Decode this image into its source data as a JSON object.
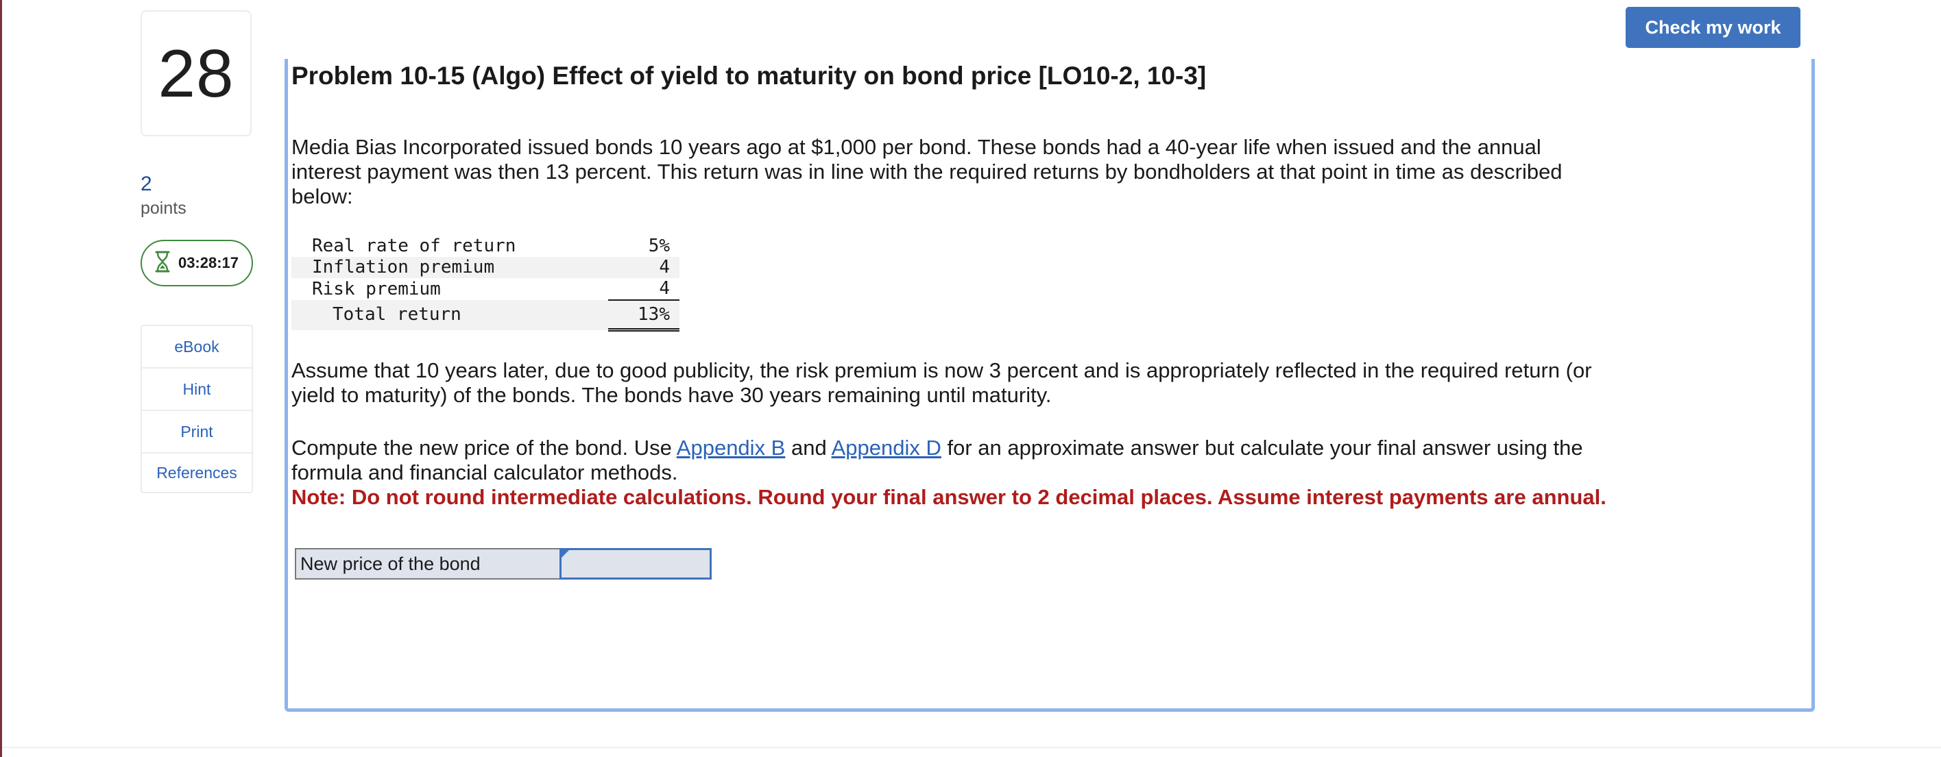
{
  "question": {
    "number": "28",
    "points_value": "2",
    "points_label": "points",
    "timer": "03:28:17"
  },
  "tools": [
    {
      "label": "eBook"
    },
    {
      "label": "Hint"
    },
    {
      "label": "Print"
    },
    {
      "label": "References"
    }
  ],
  "toolbar": {
    "check_label": "Check my work"
  },
  "problem": {
    "title": "Problem 10-15 (Algo) Effect of yield to maturity on bond price [LO10-2, 10-3]",
    "intro": "Media Bias Incorporated issued bonds 10 years ago at $1,000 per bond. These bonds had a 40-year life when issued and the annual interest payment was then 13 percent. This return was in line with the required returns by bondholders at that point in time as described below:",
    "returns_table": [
      {
        "label": "Real rate of return",
        "value": "5%"
      },
      {
        "label": "Inflation premium",
        "value": "4"
      },
      {
        "label": "Risk premium",
        "value": "4"
      },
      {
        "label": "Total return",
        "value": "13%"
      }
    ],
    "assumption": "Assume that 10 years later, due to good publicity, the risk premium is now 3 percent and is appropriately reflected in the required return (or yield to maturity) of the bonds. The bonds have 30 years remaining until maturity.",
    "compute_pre": "Compute the new price of the bond. Use ",
    "appendix_b": "Appendix B",
    "compute_and": " and ",
    "appendix_d": "Appendix D",
    "compute_post": " for an approximate answer but calculate your final answer using the formula and financial calculator methods.",
    "note": "Note: Do not round intermediate calculations. Round your final answer to 2 decimal places. Assume interest payments are annual."
  },
  "answer": {
    "label": "New price of the bond",
    "value": ""
  },
  "colors": {
    "accent": "#3f73bd",
    "panel_border": "#8fb3ec",
    "note_red": "#b01c1c",
    "timer_green": "#3f8a3f"
  }
}
